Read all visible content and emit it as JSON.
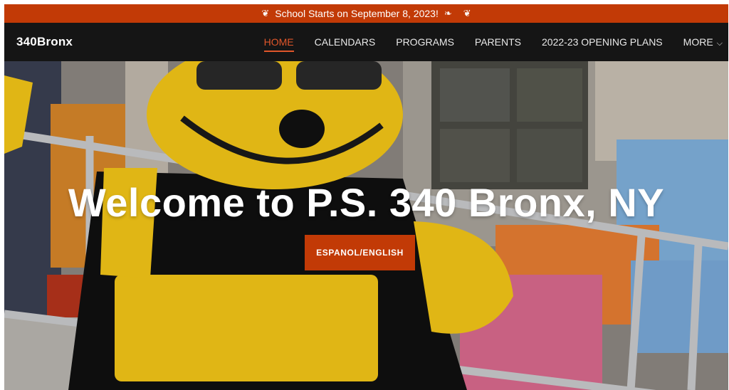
{
  "announcement": {
    "text": "School Starts on September 8, 2023!",
    "icons": [
      "leaf-icon",
      "leaf-icon",
      "leaf-icon"
    ]
  },
  "nav": {
    "logo": "340Bronx",
    "items": [
      {
        "label": "HOME",
        "active": true
      },
      {
        "label": "CALENDARS"
      },
      {
        "label": "PROGRAMS"
      },
      {
        "label": "PARENTS"
      },
      {
        "label": "2022-23 OPENING PLANS"
      },
      {
        "label": "MORE",
        "icon": "chevron-down-icon"
      }
    ]
  },
  "hero": {
    "headline": "Welcome to P.S. 340 Bronx, NY",
    "cta_label": "ESPANOL/ENGLISH"
  },
  "colors": {
    "accent": "#c23a06",
    "nav_bg": "#151515",
    "active_link": "#e0562a"
  }
}
